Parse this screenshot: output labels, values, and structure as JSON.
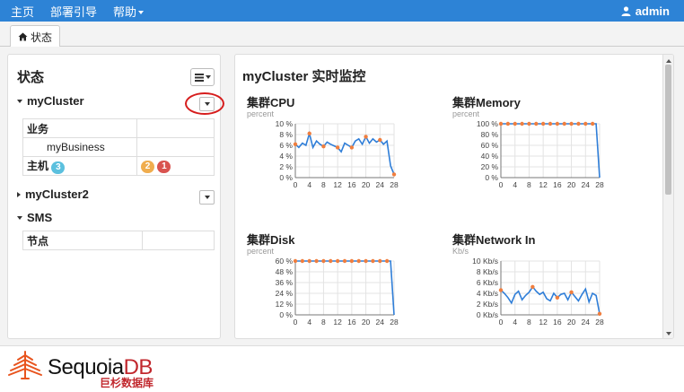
{
  "nav": {
    "items": [
      "主页",
      "部署引导",
      "帮助"
    ],
    "user": "admin"
  },
  "tabs": [
    {
      "label": "状态",
      "active": true
    }
  ],
  "left_panel": {
    "title": "状态",
    "clusters": [
      {
        "name": "myCluster",
        "expanded": true,
        "rows": [
          {
            "label": "业务"
          },
          {
            "label": "myBusiness"
          },
          {
            "label": "主机",
            "count": "3",
            "warning": "2",
            "error": "1"
          }
        ]
      },
      {
        "name": "myCluster2",
        "expanded": false
      },
      {
        "name": "SMS",
        "expanded": true,
        "rows": [
          {
            "label": "节点"
          }
        ]
      }
    ]
  },
  "monitor": {
    "title": "myCluster 实时监控",
    "charts": [
      {
        "title": "集群CPU",
        "unit": "percent"
      },
      {
        "title": "集群Memory",
        "unit": "percent"
      },
      {
        "title": "集群Disk",
        "unit": "percent"
      },
      {
        "title": "集群Network In",
        "unit": "Kb/s"
      }
    ]
  },
  "chart_data": [
    {
      "type": "line",
      "title": "集群CPU",
      "ylabel": "percent",
      "ylim": [
        0,
        10
      ],
      "yticks": [
        "10 %",
        "8 %",
        "6 %",
        "4 %",
        "2 %",
        "0 %"
      ],
      "xticks": [
        "0",
        "4",
        "8",
        "12",
        "16",
        "20",
        "24",
        "28"
      ],
      "x": [
        0,
        1,
        2,
        3,
        4,
        5,
        6,
        7,
        8,
        9,
        10,
        11,
        12,
        13,
        14,
        15,
        16,
        17,
        18,
        19,
        20,
        21,
        22,
        23,
        24,
        25,
        26,
        27,
        28
      ],
      "series": [
        {
          "values": [
            6.2,
            5.6,
            6.4,
            6.0,
            8.2,
            5.6,
            6.8,
            6.2,
            5.8,
            6.6,
            6.2,
            5.9,
            5.6,
            4.8,
            6.4,
            6.0,
            5.6,
            6.8,
            7.2,
            6.2,
            7.6,
            6.4,
            7.2,
            6.6,
            7.0,
            6.2,
            6.8,
            2.2,
            0.6
          ]
        }
      ],
      "marker_x": [
        0,
        4,
        8,
        12,
        16,
        20,
        24,
        28
      ],
      "line_color": "#2f7ed8",
      "marker_color": "#f07e3e"
    },
    {
      "type": "line",
      "title": "集群Memory",
      "ylabel": "percent",
      "ylim": [
        0,
        100
      ],
      "yticks": [
        "100 %",
        "80 %",
        "60 %",
        "40 %",
        "20 %",
        "0 %"
      ],
      "xticks": [
        "0",
        "4",
        "8",
        "12",
        "16",
        "20",
        "24",
        "28"
      ],
      "x": [
        0,
        1,
        2,
        3,
        4,
        5,
        6,
        7,
        8,
        9,
        10,
        11,
        12,
        13,
        14,
        15,
        16,
        17,
        18,
        19,
        20,
        21,
        22,
        23,
        24,
        25,
        26,
        27,
        28
      ],
      "series": [
        {
          "values": [
            100,
            100,
            100,
            100,
            100,
            100,
            100,
            100,
            100,
            100,
            100,
            100,
            100,
            100,
            100,
            100,
            100,
            100,
            100,
            100,
            100,
            100,
            100,
            100,
            100,
            100,
            100,
            100,
            0
          ]
        }
      ],
      "marker_x": [
        0,
        2,
        4,
        6,
        8,
        10,
        12,
        14,
        16,
        18,
        20,
        22,
        24,
        26
      ],
      "line_color": "#2f7ed8",
      "marker_color": "#f07e3e"
    },
    {
      "type": "line",
      "title": "集群Disk",
      "ylabel": "percent",
      "ylim": [
        0,
        60
      ],
      "yticks": [
        "60 %",
        "48 %",
        "36 %",
        "24 %",
        "12 %",
        "0 %"
      ],
      "xticks": [
        "0",
        "4",
        "8",
        "12",
        "16",
        "20",
        "24",
        "28"
      ],
      "x": [
        0,
        1,
        2,
        3,
        4,
        5,
        6,
        7,
        8,
        9,
        10,
        11,
        12,
        13,
        14,
        15,
        16,
        17,
        18,
        19,
        20,
        21,
        22,
        23,
        24,
        25,
        26,
        27,
        28
      ],
      "series": [
        {
          "values": [
            60,
            60,
            60,
            60,
            60,
            60,
            60,
            60,
            60,
            60,
            60,
            60,
            60,
            60,
            60,
            60,
            60,
            60,
            60,
            60,
            60,
            60,
            60,
            60,
            60,
            60,
            60,
            60,
            0
          ]
        }
      ],
      "marker_x": [
        0,
        2,
        4,
        6,
        8,
        10,
        12,
        14,
        16,
        18,
        20,
        22,
        24,
        26
      ],
      "line_color": "#2f7ed8",
      "marker_color": "#f07e3e"
    },
    {
      "type": "line",
      "title": "集群Network In",
      "ylabel": "Kb/s",
      "ylim": [
        0,
        10
      ],
      "yticks": [
        "10 Kb/s",
        "8 Kb/s",
        "6 Kb/s",
        "4 Kb/s",
        "2 Kb/s",
        "0 Kb/s"
      ],
      "xticks": [
        "0",
        "4",
        "8",
        "12",
        "16",
        "20",
        "24",
        "28"
      ],
      "x": [
        0,
        1,
        2,
        3,
        4,
        5,
        6,
        7,
        8,
        9,
        10,
        11,
        12,
        13,
        14,
        15,
        16,
        17,
        18,
        19,
        20,
        21,
        22,
        23,
        24,
        25,
        26,
        27,
        28
      ],
      "series": [
        {
          "values": [
            4.6,
            4.0,
            3.2,
            2.2,
            3.8,
            4.4,
            2.8,
            3.6,
            4.2,
            5.2,
            4.4,
            3.8,
            4.2,
            3.0,
            2.6,
            4.0,
            3.2,
            3.8,
            4.0,
            2.8,
            4.2,
            3.4,
            2.6,
            3.8,
            4.8,
            2.4,
            4.0,
            3.6,
            0.2
          ]
        }
      ],
      "marker_x": [
        0,
        9,
        16,
        20,
        28
      ],
      "line_color": "#2f7ed8",
      "marker_color": "#f07e3e"
    }
  ],
  "footer": {
    "brand_main": "Sequoia",
    "brand_accent": "DB",
    "brand_sub": "巨杉数据库"
  }
}
